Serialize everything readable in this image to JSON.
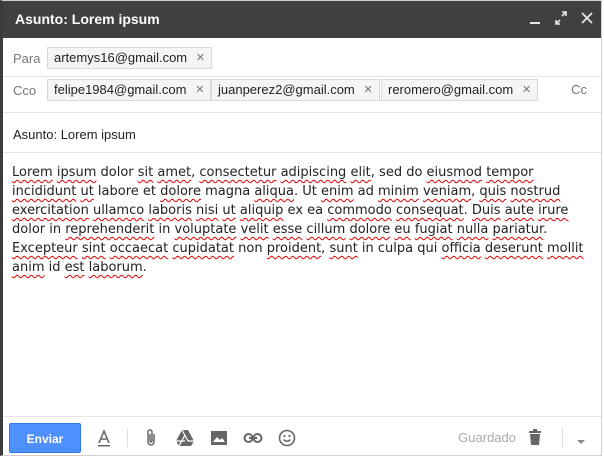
{
  "window": {
    "title": "Asunto: Lorem ipsum",
    "icons": [
      "minimize-icon",
      "expand-icon",
      "close-icon"
    ]
  },
  "to": {
    "label": "Para",
    "recipients": [
      "artemys16@gmail.com"
    ]
  },
  "bcc": {
    "label": "Cco",
    "recipients": [
      "felipe1984@gmail.com",
      "juanperez2@gmail.com",
      "reromero@gmail.com"
    ]
  },
  "cc_label": "Cc",
  "subject": "Asunto: Lorem ipsum",
  "body": {
    "segments": [
      {
        "t": "Lorem",
        "sp": true
      },
      {
        "t": " "
      },
      {
        "t": "ipsum",
        "sp": true
      },
      {
        "t": " dolor "
      },
      {
        "t": "sit",
        "sp": true
      },
      {
        "t": " "
      },
      {
        "t": "amet",
        "sp": true
      },
      {
        "t": ", "
      },
      {
        "t": "consectetur",
        "sp": true
      },
      {
        "t": " "
      },
      {
        "t": "adipiscing",
        "sp": true
      },
      {
        "t": " "
      },
      {
        "t": "elit",
        "sp": true
      },
      {
        "t": ", sed do "
      },
      {
        "t": "eiusmod",
        "sp": true
      },
      {
        "t": " "
      },
      {
        "t": "tempor",
        "sp": true
      },
      {
        "t": " "
      },
      {
        "t": "incididunt",
        "sp": true
      },
      {
        "t": " "
      },
      {
        "t": "ut",
        "sp": true
      },
      {
        "t": " labore et "
      },
      {
        "t": "dolore",
        "sp": true
      },
      {
        "t": " magna "
      },
      {
        "t": "aliqua",
        "sp": true
      },
      {
        "t": ". Ut "
      },
      {
        "t": "enim",
        "sp": true
      },
      {
        "t": " ad "
      },
      {
        "t": "minim",
        "sp": true
      },
      {
        "t": " "
      },
      {
        "t": "veniam",
        "sp": true
      },
      {
        "t": ", "
      },
      {
        "t": "quis",
        "sp": true
      },
      {
        "t": " "
      },
      {
        "t": "nostrud",
        "sp": true
      },
      {
        "t": " "
      },
      {
        "t": "exercitation",
        "sp": true
      },
      {
        "t": " "
      },
      {
        "t": "ullamco",
        "sp": true
      },
      {
        "t": " "
      },
      {
        "t": "laboris",
        "sp": true
      },
      {
        "t": " "
      },
      {
        "t": "nisi",
        "sp": true
      },
      {
        "t": " "
      },
      {
        "t": "ut",
        "sp": true
      },
      {
        "t": " "
      },
      {
        "t": "aliquip",
        "sp": true
      },
      {
        "t": " ex ea "
      },
      {
        "t": "commodo",
        "sp": true
      },
      {
        "t": " "
      },
      {
        "t": "consequat",
        "sp": true
      },
      {
        "t": ". "
      },
      {
        "t": "Duis",
        "sp": true
      },
      {
        "t": " "
      },
      {
        "t": "aute",
        "sp": true
      },
      {
        "t": " "
      },
      {
        "t": "irure",
        "sp": true
      },
      {
        "t": " dolor in "
      },
      {
        "t": "reprehenderit",
        "sp": true
      },
      {
        "t": " in "
      },
      {
        "t": "voluptate",
        "sp": true
      },
      {
        "t": " "
      },
      {
        "t": "velit",
        "sp": true
      },
      {
        "t": " "
      },
      {
        "t": "esse",
        "sp": true
      },
      {
        "t": " "
      },
      {
        "t": "cillum",
        "sp": true
      },
      {
        "t": " "
      },
      {
        "t": "dolore",
        "sp": true
      },
      {
        "t": " "
      },
      {
        "t": "eu",
        "sp": true
      },
      {
        "t": " "
      },
      {
        "t": "fugiat",
        "sp": true
      },
      {
        "t": " "
      },
      {
        "t": "nulla",
        "sp": true
      },
      {
        "t": " "
      },
      {
        "t": "pariatur",
        "sp": true
      },
      {
        "t": ". "
      },
      {
        "t": "Excepteur",
        "sp": true
      },
      {
        "t": " "
      },
      {
        "t": "sint",
        "sp": true
      },
      {
        "t": " "
      },
      {
        "t": "occaecat",
        "sp": true
      },
      {
        "t": " "
      },
      {
        "t": "cupidatat",
        "sp": true
      },
      {
        "t": " non "
      },
      {
        "t": "proident",
        "sp": true
      },
      {
        "t": ", "
      },
      {
        "t": "sunt",
        "sp": true
      },
      {
        "t": " in culpa qui "
      },
      {
        "t": "officia",
        "sp": true
      },
      {
        "t": " "
      },
      {
        "t": "deserunt",
        "sp": true
      },
      {
        "t": " "
      },
      {
        "t": "mollit",
        "sp": true
      },
      {
        "t": " "
      },
      {
        "t": "anim",
        "sp": true
      },
      {
        "t": " id "
      },
      {
        "t": "est",
        "sp": true
      },
      {
        "t": " "
      },
      {
        "t": "laborum",
        "sp": true
      },
      {
        "t": "."
      }
    ]
  },
  "footer": {
    "send_label": "Enviar",
    "status": "Guardado",
    "icons": [
      "text-format-icon",
      "attach-icon",
      "drive-icon",
      "photo-icon",
      "link-icon",
      "emoji-icon",
      "trash-icon",
      "more-options-icon"
    ]
  },
  "colors": {
    "titlebar": "#404040",
    "send_button": "#4d90fe",
    "spell_underline": "#e00000"
  }
}
